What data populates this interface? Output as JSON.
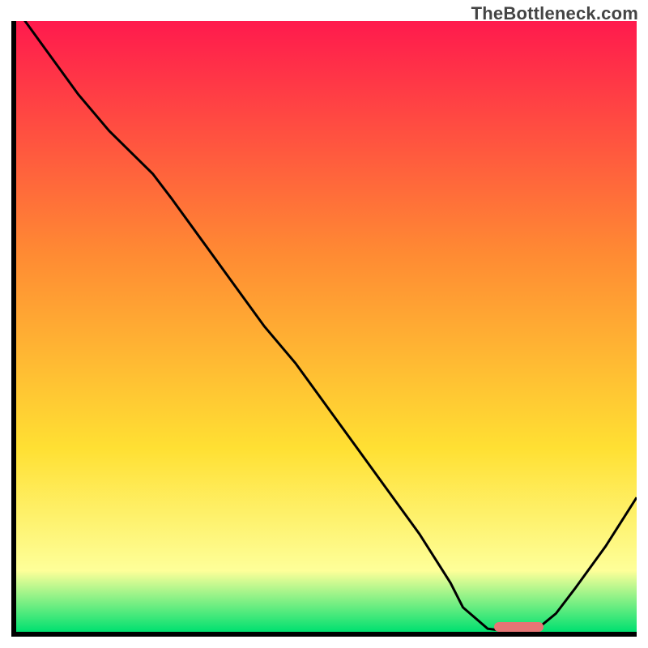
{
  "watermark": "TheBottleneck.com",
  "colors": {
    "gradient_top": "#ff1a4d",
    "gradient_mid1": "#ff8a33",
    "gradient_mid2": "#ffe033",
    "gradient_mid3": "#feff99",
    "gradient_bottom": "#00e070",
    "line": "#000000",
    "marker": "#e77575",
    "axis": "#000000"
  },
  "chart_data": {
    "type": "line",
    "title": "",
    "xlabel": "",
    "ylabel": "",
    "xlim": [
      0,
      100
    ],
    "ylim": [
      0,
      100
    ],
    "grid": false,
    "x": [
      0,
      5,
      10,
      15,
      20,
      22,
      25,
      30,
      35,
      40,
      45,
      50,
      55,
      60,
      65,
      70,
      72,
      76,
      80,
      84,
      87,
      90,
      95,
      100
    ],
    "values": [
      102,
      95,
      88,
      82,
      77,
      75,
      71,
      64,
      57,
      50,
      44,
      37,
      30,
      23,
      16,
      8,
      4,
      0.5,
      0,
      0.5,
      3,
      7,
      14,
      22
    ],
    "marker_segment": {
      "x_start": 77,
      "x_end": 85,
      "y": 0.8
    }
  }
}
